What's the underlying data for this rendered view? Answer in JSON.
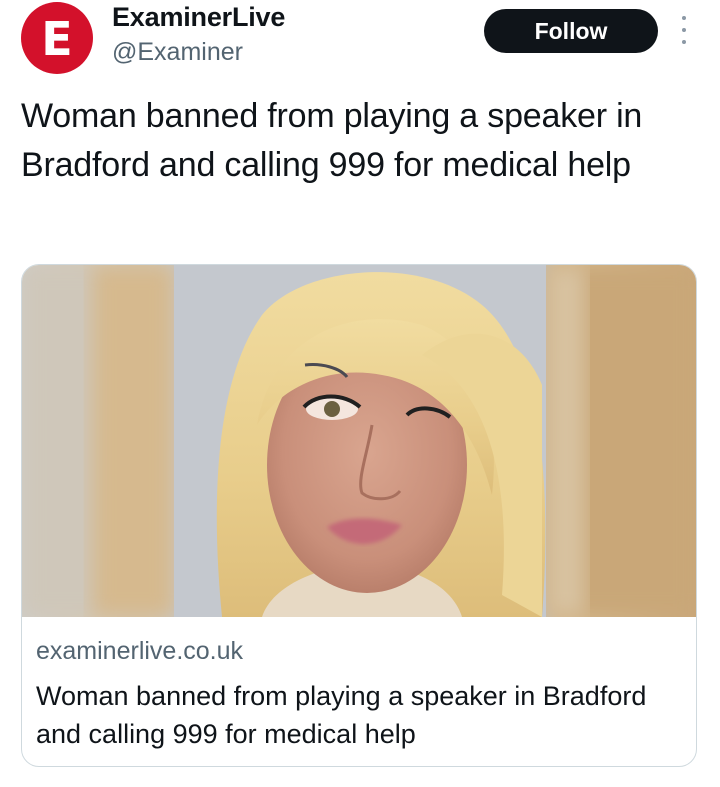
{
  "header": {
    "avatar_letter": "E",
    "display_name": "ExaminerLive",
    "handle": "@Examiner",
    "follow_label": "Follow",
    "more_icon": "vertical-ellipsis-icon"
  },
  "tweet": {
    "text": "Woman banned from playing a speaker in Bradford and calling 999 for medical help"
  },
  "card": {
    "domain": "examinerlive.co.uk",
    "title": "Woman banned from playing a speaker in Bradford and calling 999 for medical help",
    "image": "portrait-photo"
  },
  "colors": {
    "brand": "#d3112b",
    "button_bg": "#0f1419",
    "secondary_text": "#536471",
    "card_border": "#cfd9de"
  }
}
